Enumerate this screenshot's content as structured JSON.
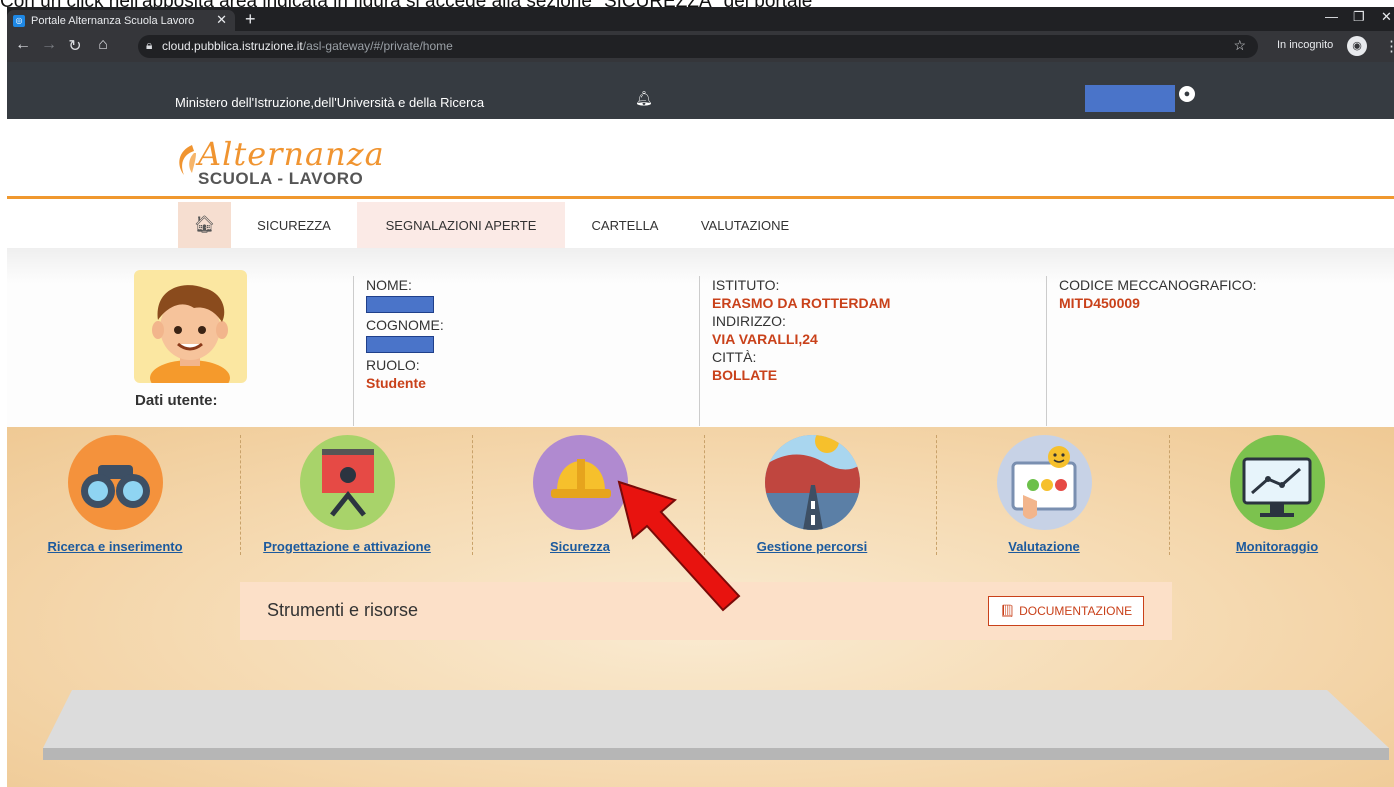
{
  "caption": "Con un click nell'apposita area indicata in figura si accede alla sezione \"SICUREZZA\" del portale",
  "browser": {
    "tab_title": "Portale Alternanza Scuola Lavoro",
    "url_host": "cloud.pubblica.istruzione.it",
    "url_path": "/asl-gateway/#/private/home",
    "incognito_label": "In incognito"
  },
  "header": {
    "ministry": "Ministero dell'Istruzione,dell'Università e della Ricerca"
  },
  "logo": {
    "script": "Alternanza",
    "sub": "SCUOLA - LAVORO"
  },
  "nav": {
    "items": [
      "SICUREZZA",
      "SEGNALAZIONI APERTE",
      "CARTELLA",
      "VALUTAZIONE"
    ]
  },
  "user": {
    "dati_label": "Dati utente:",
    "nome_label": "NOME:",
    "cognome_label": "COGNOME:",
    "ruolo_label": "RUOLO:",
    "ruolo_value": "Studente",
    "istituto_label": "ISTITUTO:",
    "istituto_value": "ERASMO DA ROTTERDAM",
    "indirizzo_label": "INDIRIZZO:",
    "indirizzo_value": "VIA VARALLI,24",
    "citta_label": "CITTÀ:",
    "citta_value": "BOLLATE",
    "codice_label": "CODICE MECCANOGRAFICO:",
    "codice_value": "MITD450009"
  },
  "tiles": [
    {
      "label": "Ricerca e inserimento",
      "icon": "binoculars-icon",
      "color": "#f4923c"
    },
    {
      "label": "Progettazione e attivazione",
      "icon": "presentation-icon",
      "color": "#a8d36a"
    },
    {
      "label": "Sicurezza",
      "icon": "hardhat-icon",
      "color": "#b08ad0"
    },
    {
      "label": "Gestione percorsi",
      "icon": "road-icon",
      "color": "#7da9d8"
    },
    {
      "label": "Valutazione",
      "icon": "touchscreen-icon",
      "color": "#c7d2e6"
    },
    {
      "label": "Monitoraggio",
      "icon": "chart-monitor-icon",
      "color": "#7cc24e"
    }
  ],
  "strumenti": {
    "title": "Strumenti e risorse",
    "doc_button": "DOCUMENTAZIONE"
  }
}
